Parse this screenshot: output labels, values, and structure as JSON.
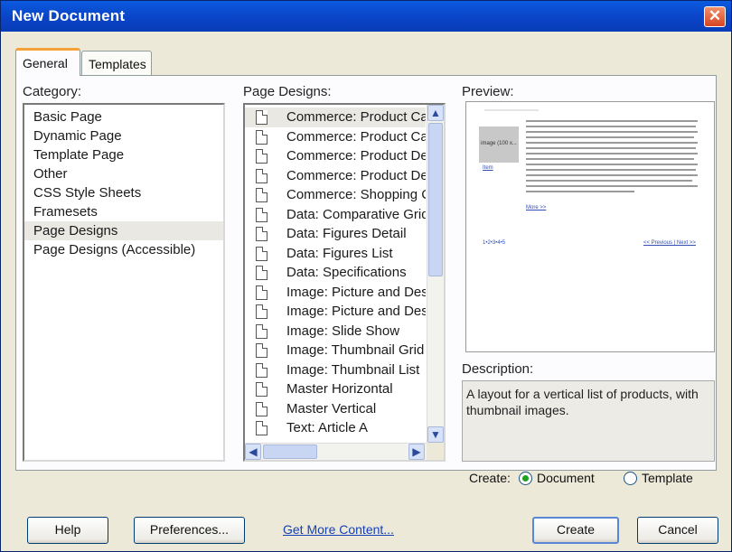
{
  "window": {
    "title": "New Document",
    "close_glyph": "✕"
  },
  "tabs": [
    {
      "label": "General",
      "active": true
    },
    {
      "label": "Templates",
      "active": false
    }
  ],
  "category": {
    "label": "Category:",
    "items": [
      "Basic Page",
      "Dynamic Page",
      "Template Page",
      "Other",
      "CSS Style Sheets",
      "Framesets",
      "Page Designs",
      "Page Designs (Accessible)"
    ],
    "selected": "Page Designs"
  },
  "page_designs": {
    "label": "Page Designs:",
    "items": [
      "Commerce: Product Ca",
      "Commerce: Product Ca",
      "Commerce: Product De",
      "Commerce: Product De",
      "Commerce: Shopping C",
      "Data: Comparative Grid",
      "Data: Figures Detail",
      "Data: Figures List",
      "Data: Specifications",
      "Image: Picture and Des",
      "Image: Picture and Des",
      "Image: Slide Show",
      "Image: Thumbnail Grid",
      "Image: Thumbnail List",
      "Master Horizontal",
      "Master Vertical",
      "Text: Article A"
    ],
    "selected_index": 0,
    "scroll_glyphs": {
      "up": "▲",
      "down": "▼",
      "left": "◀",
      "right": "▶"
    }
  },
  "preview": {
    "label": "Preview:",
    "image_caption": "image (100 x...",
    "image_link": "Item",
    "more_link": "More >>",
    "pages": "1•2•3•4•5",
    "nav": "<< Previous | Next >>"
  },
  "description": {
    "label": "Description:",
    "text": "A layout for a vertical list of products, with thumbnail images."
  },
  "create": {
    "label": "Create:",
    "options": [
      {
        "label": "Document",
        "selected": true
      },
      {
        "label": "Template",
        "selected": false
      }
    ]
  },
  "buttons": {
    "help": "Help",
    "preferences": "Preferences...",
    "get_more": "Get More Content...",
    "create": "Create",
    "cancel": "Cancel"
  },
  "colors": {
    "title_bar": "#0a45c8",
    "radio_selected": "#21a121",
    "tab_accent": "#f5a13a"
  }
}
